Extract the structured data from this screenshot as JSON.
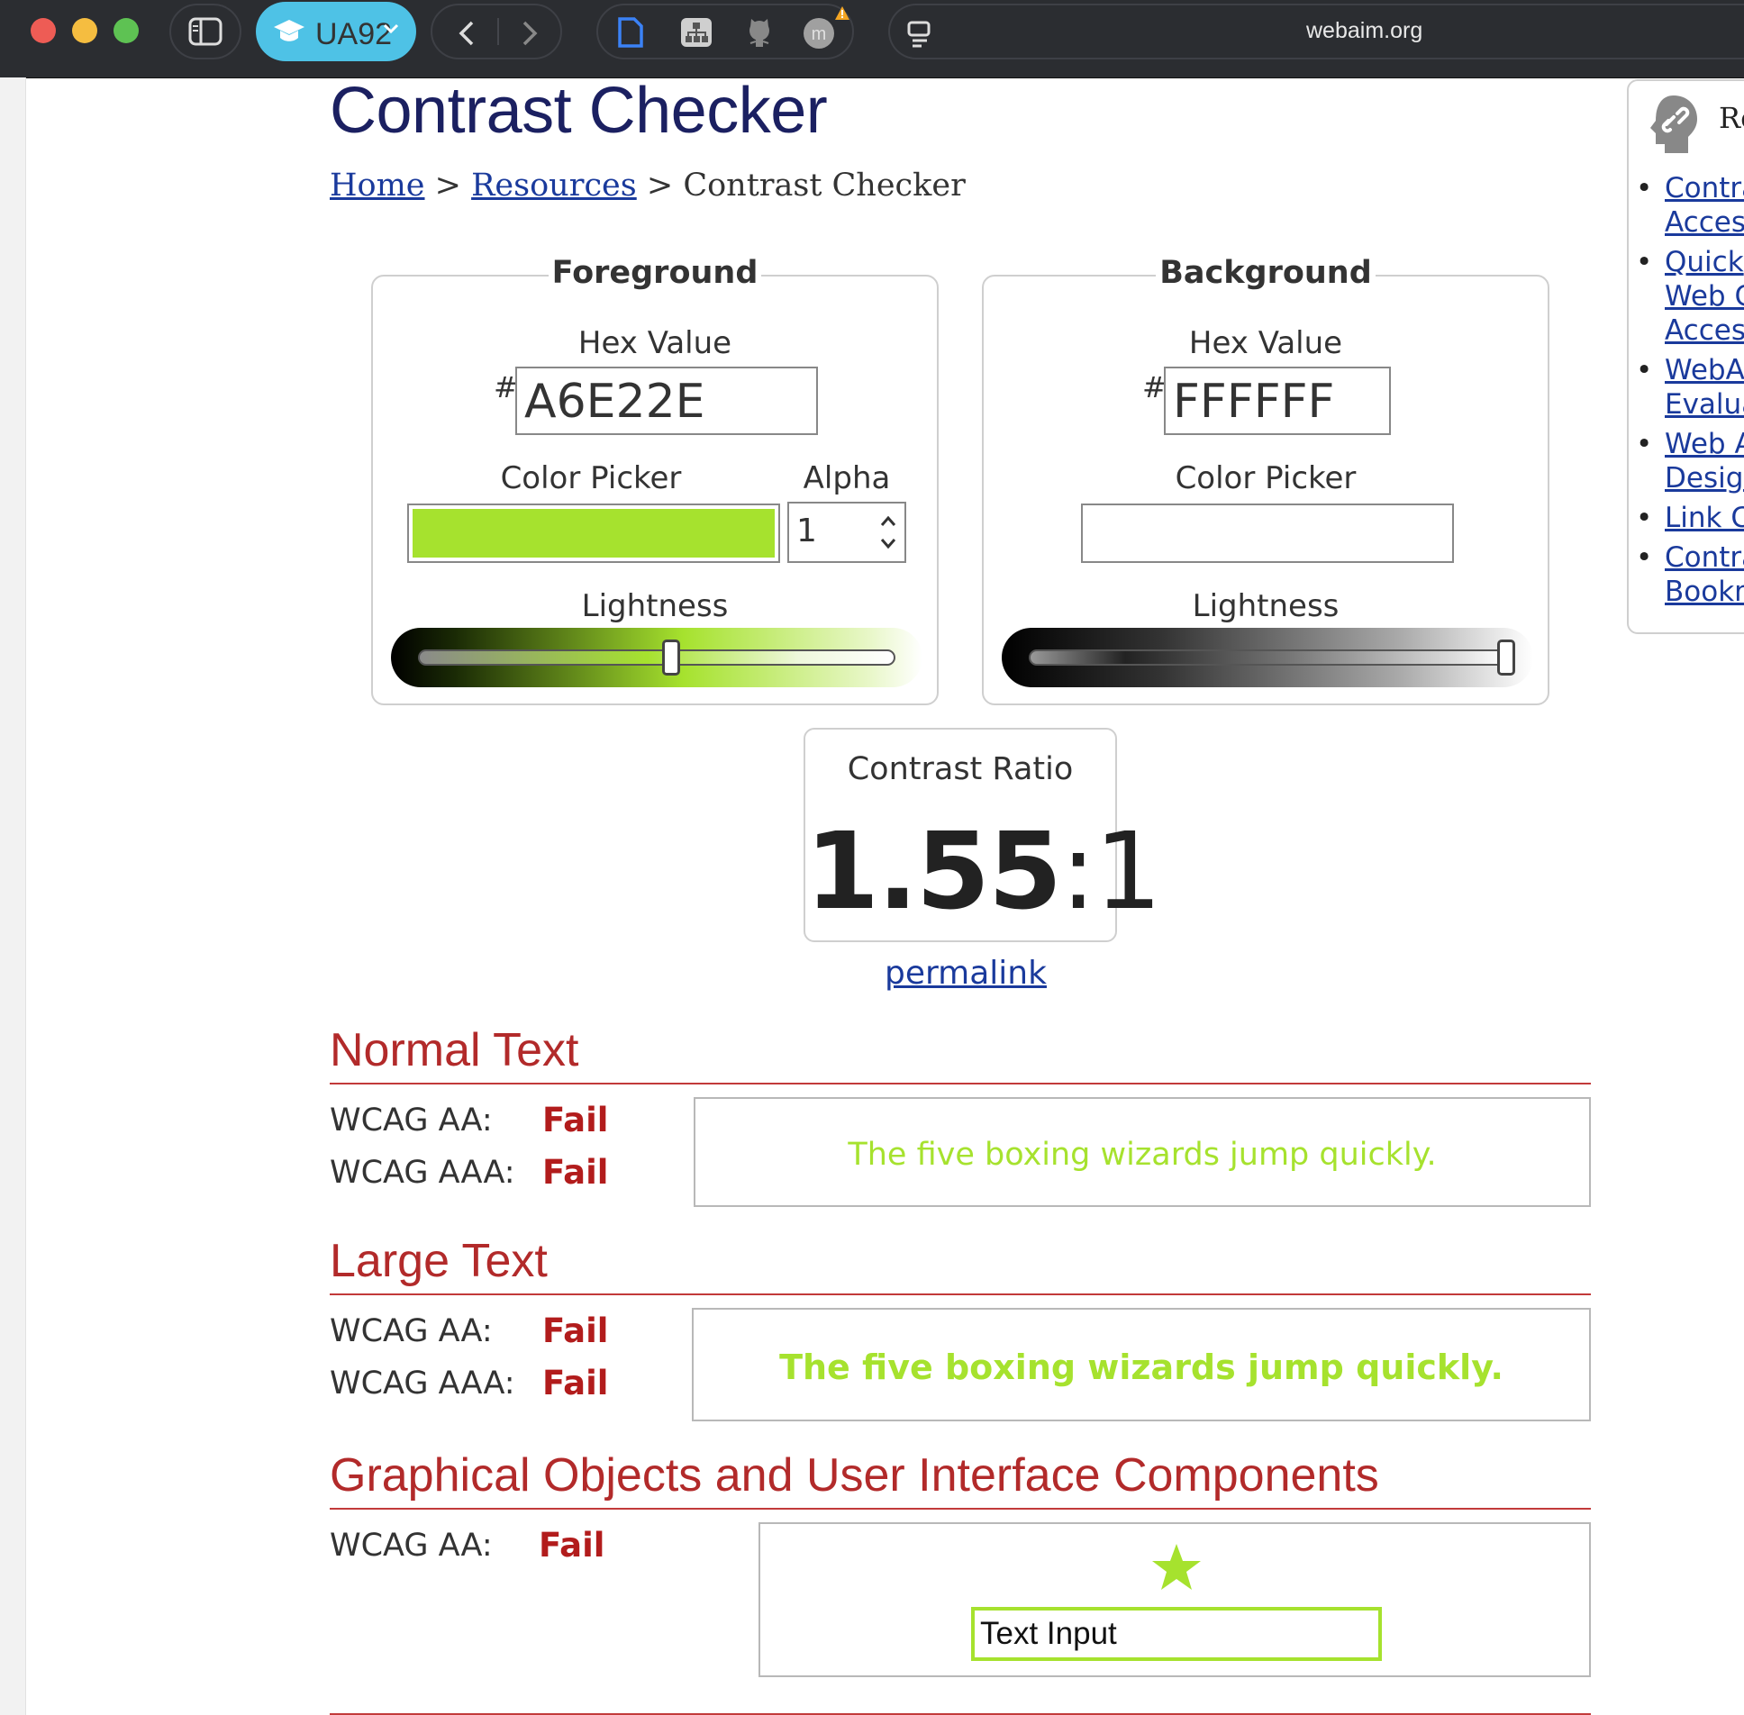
{
  "browser": {
    "tab_group_label": "UA92",
    "url": "webaim.org"
  },
  "page": {
    "title": "Contrast Checker",
    "breadcrumb": {
      "home": "Home",
      "sep1": " > ",
      "resources": "Resources",
      "sep2": " > ",
      "current": "Contrast Checker"
    }
  },
  "foreground": {
    "legend": "Foreground",
    "hex_label": "Hex Value",
    "hash": "#",
    "hex_value": "A6E22E",
    "color_picker_label": "Color Picker",
    "alpha_label": "Alpha",
    "alpha_value": "1",
    "lightness_label": "Lightness",
    "lightness_level": 0.53,
    "color": "#a6e22e"
  },
  "background": {
    "legend": "Background",
    "hex_label": "Hex Value",
    "hash": "#",
    "hex_value": "FFFFFF",
    "color_picker_label": "Color Picker",
    "lightness_label": "Lightness",
    "lightness_level": 1.0,
    "color": "#ffffff"
  },
  "contrast": {
    "label": "Contrast Ratio",
    "value": "1.55",
    "suffix": ":1",
    "permalink": "permalink"
  },
  "normal_text": {
    "title": "Normal Text",
    "aa_label": "WCAG AA:",
    "aa_result": "Fail",
    "aaa_label": "WCAG AAA:",
    "aaa_result": "Fail",
    "sample": "The five boxing wizards jump quickly."
  },
  "large_text": {
    "title": "Large Text",
    "aa_label": "WCAG AA:",
    "aa_result": "Fail",
    "aaa_label": "WCAG AAA:",
    "aaa_result": "Fail",
    "sample": "The five boxing wizards jump quickly."
  },
  "graphical": {
    "title": "Graphical Objects and User Interface Components",
    "aa_label": "WCAG AA:",
    "aa_result": "Fail",
    "input_text": "Text Input"
  },
  "resources": {
    "heading": "Re",
    "items": [
      {
        "line1": "Contra",
        "line2": "Access"
      },
      {
        "line1": "Quick ",
        "line2": "Web C",
        "line3": "Access"
      },
      {
        "line1": "WebAI",
        "line2": "Evalua"
      },
      {
        "line1": "Web A",
        "line2": "Design"
      },
      {
        "line1": "Link Co"
      },
      {
        "line1": "Contra",
        "line2": "Bookm"
      }
    ]
  },
  "colors": {
    "accent_title": "#1b2061",
    "link": "#1a3a9c",
    "section_heading": "#b22a2a",
    "fail": "#b21c1c",
    "tab_group": "#4ec2e6"
  }
}
